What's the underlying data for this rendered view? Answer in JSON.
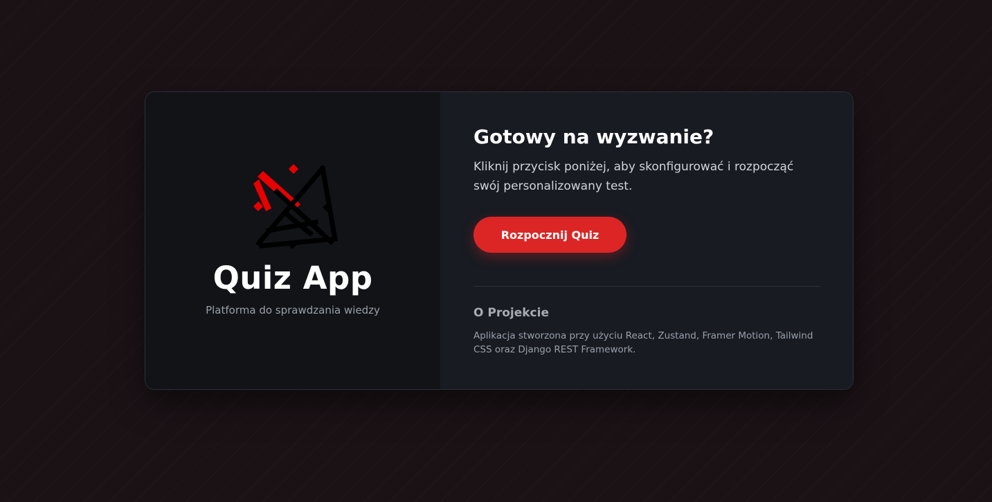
{
  "app": {
    "title": "Quiz App",
    "subtitle": "Platforma do sprawdzania wiedzy",
    "logo_icon": "crossed-swords-icon"
  },
  "intro": {
    "heading": "Gotowy na wyzwanie?",
    "text": "Kliknij przycisk poniżej, aby skonfigurować i rozpocząć swój personalizowany test.",
    "start_label": "Rozpocznij Quiz"
  },
  "about": {
    "title": "O Projekcie",
    "text": "Aplikacja stworzona przy użyciu React, Zustand, Framer Motion, Tailwind CSS oraz Django REST Framework."
  },
  "colors": {
    "accent": "#dc2626",
    "logo_red": "#e60000",
    "page_bg": "#1b1216",
    "card_left_bg": "#111317",
    "card_right_bg": "#181b22"
  }
}
